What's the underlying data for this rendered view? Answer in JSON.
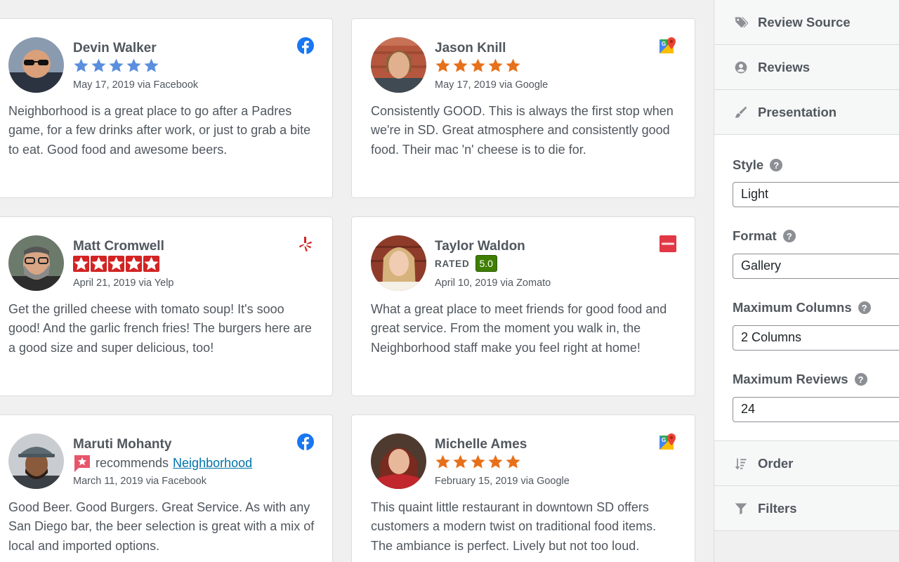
{
  "reviews": [
    {
      "name": "Devin Walker",
      "meta": "May 17, 2019 via Facebook",
      "text": "Neighborhood is a great place to go after a Padres game, for a few drinks after work, or just to grab a bite to eat. Good food and awesome beers.",
      "source_icon": "facebook-icon",
      "rating": 5,
      "star_color": "#5b8fde"
    },
    {
      "name": "Jason Knill",
      "meta": "May 17, 2019 via Google",
      "text": "Consistently GOOD. This is always the first stop when we're in SD. Great atmosphere and consistently good food. Their mac 'n' cheese is to die for.",
      "source_icon": "google-maps-icon",
      "rating": 5,
      "star_color": "#e7711b"
    },
    {
      "name": "Matt Cromwell",
      "meta": "April 21, 2019 via Yelp",
      "text": "Get the grilled cheese with tomato soup! It's sooo good! And the garlic french fries! The burgers here are a good size and super delicious, too!",
      "source_icon": "yelp-icon",
      "rating": 5,
      "star_color": "#d32323"
    },
    {
      "name": "Taylor Waldon",
      "meta": "April 10, 2019 via Zomato",
      "text": "What a great place to meet friends for good food and great service. From the moment you walk in, the Neighborhood staff make you feel right at home!",
      "source_icon": "zomato-icon",
      "rated_label": "RATED",
      "rated_value": "5.0"
    },
    {
      "name": "Maruti Mohanty",
      "meta": "March 11, 2019 via Facebook",
      "text": "Good Beer. Good Burgers. Great Service. As with any San Diego bar, the beer selection is great with a mix of local and imported options.",
      "source_icon": "facebook-icon",
      "recommends_text": "recommends",
      "recommends_link": "Neighborhood"
    },
    {
      "name": "Michelle Ames",
      "meta": "February 15, 2019 via Google",
      "text": "This quaint little restaurant in downtown SD offers customers a modern twist on traditional food items. The ambiance is perfect. Lively but not too loud.",
      "source_icon": "google-maps-icon",
      "rating": 5,
      "star_color": "#e7711b"
    }
  ],
  "panel": {
    "tabs": {
      "review_source": "Review Source",
      "reviews": "Reviews",
      "presentation": "Presentation",
      "order": "Order",
      "filters": "Filters"
    },
    "style_label": "Style",
    "style_value": "Light",
    "format_label": "Format",
    "format_value": "Gallery",
    "max_columns_label": "Maximum Columns",
    "max_columns_value": "2 Columns",
    "max_reviews_label": "Maximum Reviews",
    "max_reviews_value": "24",
    "help_glyph": "?"
  }
}
